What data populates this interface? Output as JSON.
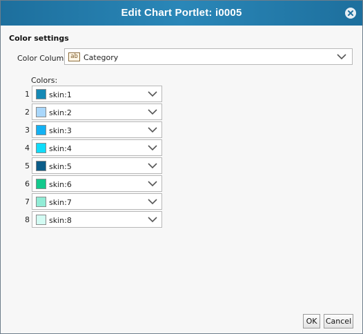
{
  "dialog": {
    "title": "Edit Chart Portlet: i0005",
    "section_title": "Color settings",
    "color_column": {
      "label": "Color Column:",
      "type_icon": "ab",
      "value": "Category"
    },
    "colors_label": "Colors:",
    "colors": [
      {
        "index": "1",
        "label": "skin:1",
        "color": "#1589b5"
      },
      {
        "index": "2",
        "label": "skin:2",
        "color": "#a9d7fb"
      },
      {
        "index": "3",
        "label": "skin:3",
        "color": "#13b1f3"
      },
      {
        "index": "4",
        "label": "skin:4",
        "color": "#10dcfa"
      },
      {
        "index": "5",
        "label": "skin:5",
        "color": "#0b5c88"
      },
      {
        "index": "6",
        "label": "skin:6",
        "color": "#14c98d"
      },
      {
        "index": "7",
        "label": "skin:7",
        "color": "#92ecd6"
      },
      {
        "index": "8",
        "label": "skin:8",
        "color": "#d3fbf3"
      }
    ],
    "buttons": {
      "ok": "OK",
      "cancel": "Cancel"
    }
  }
}
